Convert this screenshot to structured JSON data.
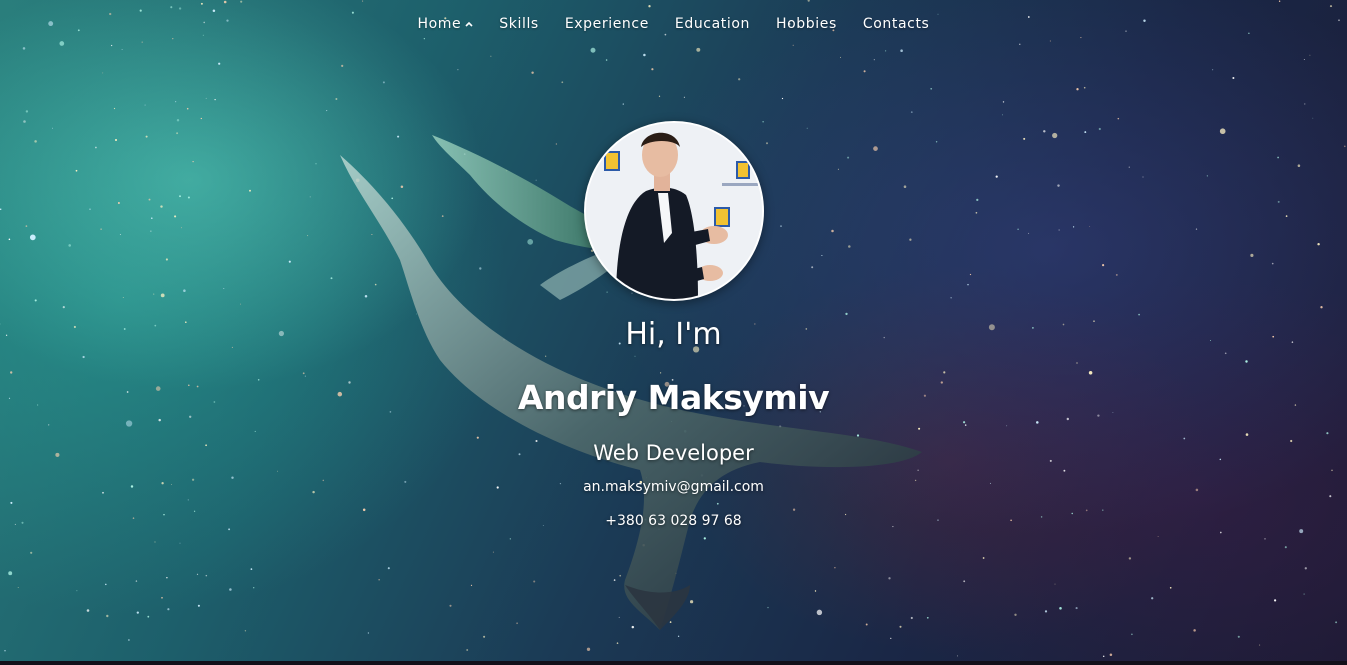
{
  "nav": {
    "items": [
      {
        "label": "Home",
        "active": true,
        "icon": "chevron-up-icon"
      },
      {
        "label": "Skills"
      },
      {
        "label": "Experience"
      },
      {
        "label": "Education"
      },
      {
        "label": "Hobbies"
      },
      {
        "label": "Contacts"
      }
    ]
  },
  "hero": {
    "greeting": "Hi, I'm",
    "name": "Andriy Maksymiv",
    "role": "Web Developer",
    "email": "an.maksymiv@gmail.com",
    "phone": "+380 63 028 97 68",
    "avatar_icon": "profile-photo"
  },
  "colors": {
    "text": "#ffffff",
    "background_teal": "#2a7e7c",
    "background_navy": "#1a2746"
  }
}
